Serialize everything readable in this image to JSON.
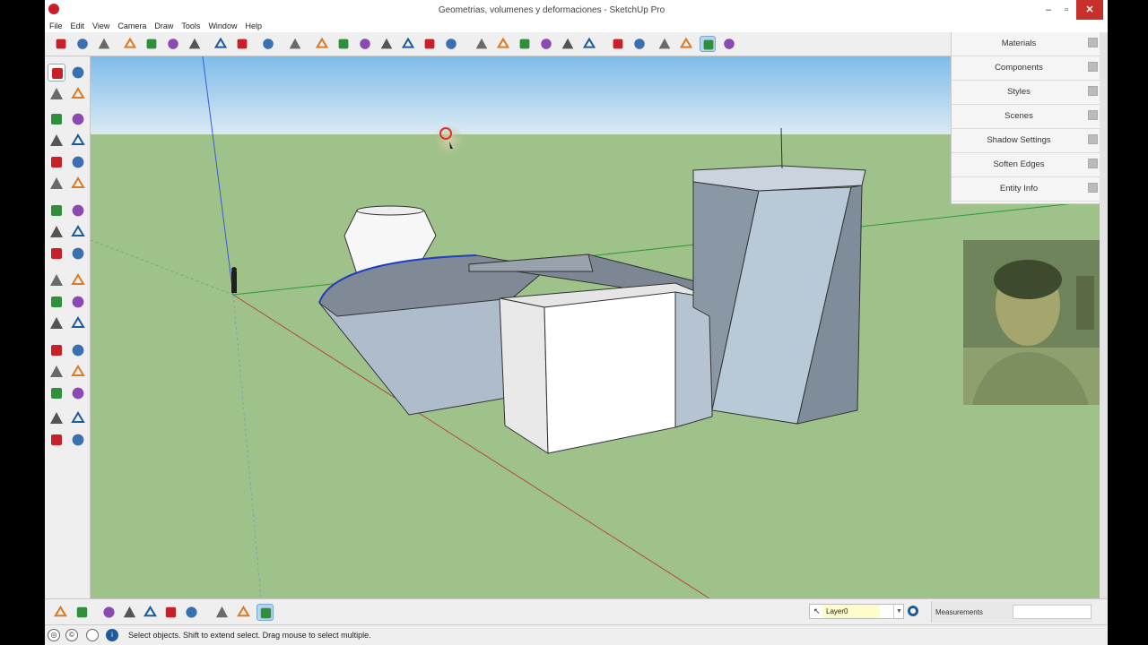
{
  "window": {
    "title": "Geometrias, volumenes y deformaciones - SketchUp Pro",
    "minimize_glyph": "–",
    "maximize_glyph": "▫",
    "close_glyph": "✕"
  },
  "menubar": {
    "items": [
      "File",
      "Edit",
      "View",
      "Camera",
      "Draw",
      "Tools",
      "Window",
      "Help"
    ]
  },
  "tray": {
    "panels": [
      "Materials",
      "Components",
      "Styles",
      "Scenes",
      "Shadow Settings",
      "Soften Edges",
      "Entity Info"
    ]
  },
  "layer": {
    "current": "Layer0",
    "cursor_glyph": "↖",
    "dropdown_glyph": "▼"
  },
  "measurements": {
    "label": "Measurements",
    "value": ""
  },
  "statusbar": {
    "hint": "Select objects. Shift to extend select. Drag mouse to select multiple.",
    "icon1": "◎",
    "icon2": "©",
    "icon3": "i"
  },
  "colors": {
    "sky_top": "#7fbcea",
    "sky_bottom": "#dceaf4",
    "ground": "#9ec28a",
    "accent_active": "#b6d4ee"
  },
  "icons": {
    "top_toolbar": [
      "new-icon",
      "open-icon",
      "save-icon",
      "cut-icon",
      "paint-icon",
      "erase-icon",
      "delete-icon",
      "undo-icon",
      "redo-icon",
      "print-icon",
      "model-info-icon",
      "3d-warehouse-icon",
      "get-models-icon",
      "share-model-icon",
      "extension-icon",
      "send-icon",
      "layout-icon",
      "iso-view-icon",
      "top-view-icon",
      "front-view-icon",
      "right-view-icon",
      "back-view-icon",
      "left-view-icon",
      "xray-icon",
      "back-edges-icon",
      "wireframe-icon",
      "hidden-line-icon",
      "shaded-icon",
      "shaded-texture-icon",
      "monochrome-icon"
    ],
    "left_toolbar": [
      "select-icon",
      "make-component-icon",
      "paint-bucket-icon",
      "eraser-icon",
      "rectangle-icon",
      "line-icon",
      "circle-icon",
      "freehand-icon",
      "polygon-icon",
      "arc-icon",
      "pie-icon",
      "two-point-arc-icon",
      "move-icon",
      "push-pull-icon",
      "rotate-icon",
      "follow-me-icon",
      "scale-icon",
      "offset-icon",
      "tape-measure-icon",
      "dimension-icon",
      "protractor-icon",
      "text-icon",
      "axes-icon",
      "3d-text-icon",
      "orbit-icon",
      "pan-icon",
      "zoom-icon",
      "zoom-window-icon",
      "zoom-extents-icon",
      "previous-icon",
      "position-camera-icon",
      "look-around-icon",
      "walk-icon",
      "section-plane-icon"
    ],
    "bottom_toolbar": [
      "section-plane-tool-icon",
      "display-section-icon",
      "iso-small-icon",
      "top-small-icon",
      "front-small-icon",
      "right-small-icon",
      "back-small-icon",
      "left-small-icon",
      "orbit-small-icon",
      "pan-small-icon",
      "zoom-small-icon"
    ]
  }
}
